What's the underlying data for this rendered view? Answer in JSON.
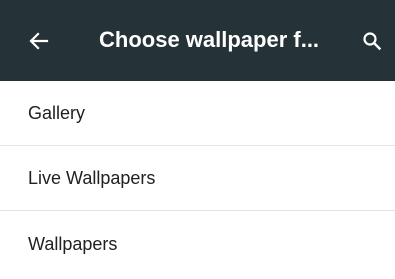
{
  "app_bar": {
    "title": "Choose wallpaper f...",
    "back_icon": "arrow-left-icon",
    "search_icon": "search-icon",
    "background_color": "#253237"
  },
  "list": {
    "items": [
      {
        "label": "Gallery"
      },
      {
        "label": "Live Wallpapers"
      },
      {
        "label": "Wallpapers"
      }
    ]
  }
}
